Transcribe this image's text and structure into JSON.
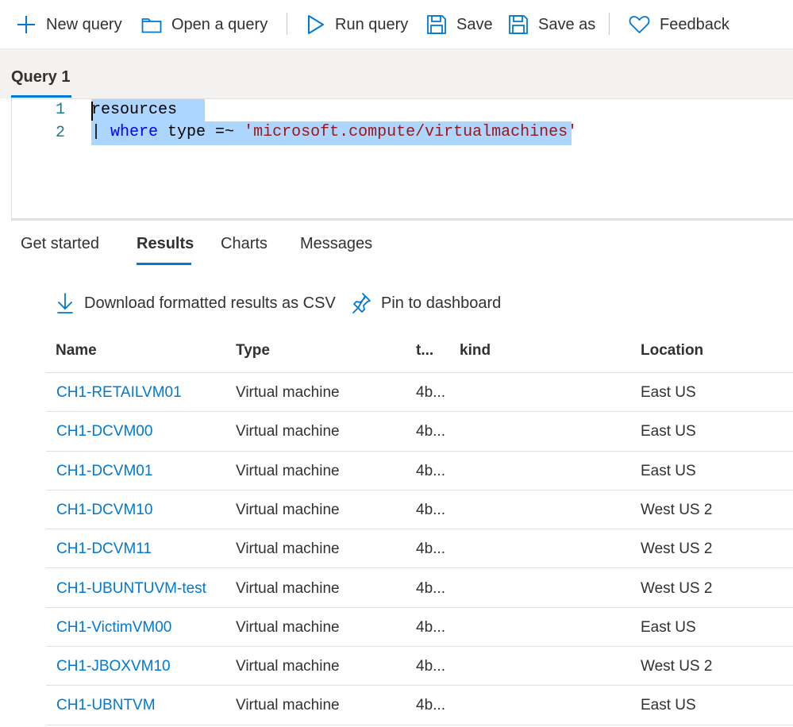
{
  "toolbar": {
    "new_query": "New query",
    "open_query": "Open a query",
    "run_query": "Run query",
    "save": "Save",
    "save_as": "Save as",
    "feedback": "Feedback"
  },
  "query_tab": {
    "label": "Query 1"
  },
  "editor": {
    "line_numbers": [
      "1",
      "2"
    ],
    "line1": "resources",
    "line2_pipe": "| ",
    "line2_keyword": "where",
    "line2_mid": " type =~ ",
    "line2_string": "'microsoft.compute/virtualmachines'"
  },
  "result_tabs": [
    "Get started",
    "Results",
    "Charts",
    "Messages"
  ],
  "active_result_tab": "Results",
  "actions": {
    "download_csv": "Download formatted results as CSV",
    "pin_dashboard": "Pin to dashboard"
  },
  "grid": {
    "columns": [
      "Name",
      "Type",
      "t...",
      "kind",
      "Location"
    ],
    "rows": [
      {
        "name": "CH1-RETAILVM01",
        "type": "Virtual machine",
        "t": "4b...",
        "kind": "",
        "location": "East US"
      },
      {
        "name": "CH1-DCVM00",
        "type": "Virtual machine",
        "t": "4b...",
        "kind": "",
        "location": "East US"
      },
      {
        "name": "CH1-DCVM01",
        "type": "Virtual machine",
        "t": "4b...",
        "kind": "",
        "location": "East US"
      },
      {
        "name": "CH1-DCVM10",
        "type": "Virtual machine",
        "t": "4b...",
        "kind": "",
        "location": "West US 2"
      },
      {
        "name": "CH1-DCVM11",
        "type": "Virtual machine",
        "t": "4b...",
        "kind": "",
        "location": "West US 2"
      },
      {
        "name": "CH1-UBUNTUVM-test",
        "type": "Virtual machine",
        "t": "4b...",
        "kind": "",
        "location": "West US 2"
      },
      {
        "name": "CH1-VictimVM00",
        "type": "Virtual machine",
        "t": "4b...",
        "kind": "",
        "location": "East US"
      },
      {
        "name": "CH1-JBOXVM10",
        "type": "Virtual machine",
        "t": "4b...",
        "kind": "",
        "location": "West US 2"
      },
      {
        "name": "CH1-UBNTVM",
        "type": "Virtual machine",
        "t": "4b...",
        "kind": "",
        "location": "East US"
      }
    ]
  },
  "colors": {
    "accent": "#0078d4",
    "selection": "#add6ff",
    "keyword": "#0000ff",
    "string": "#a31515",
    "line_number": "#237893"
  }
}
